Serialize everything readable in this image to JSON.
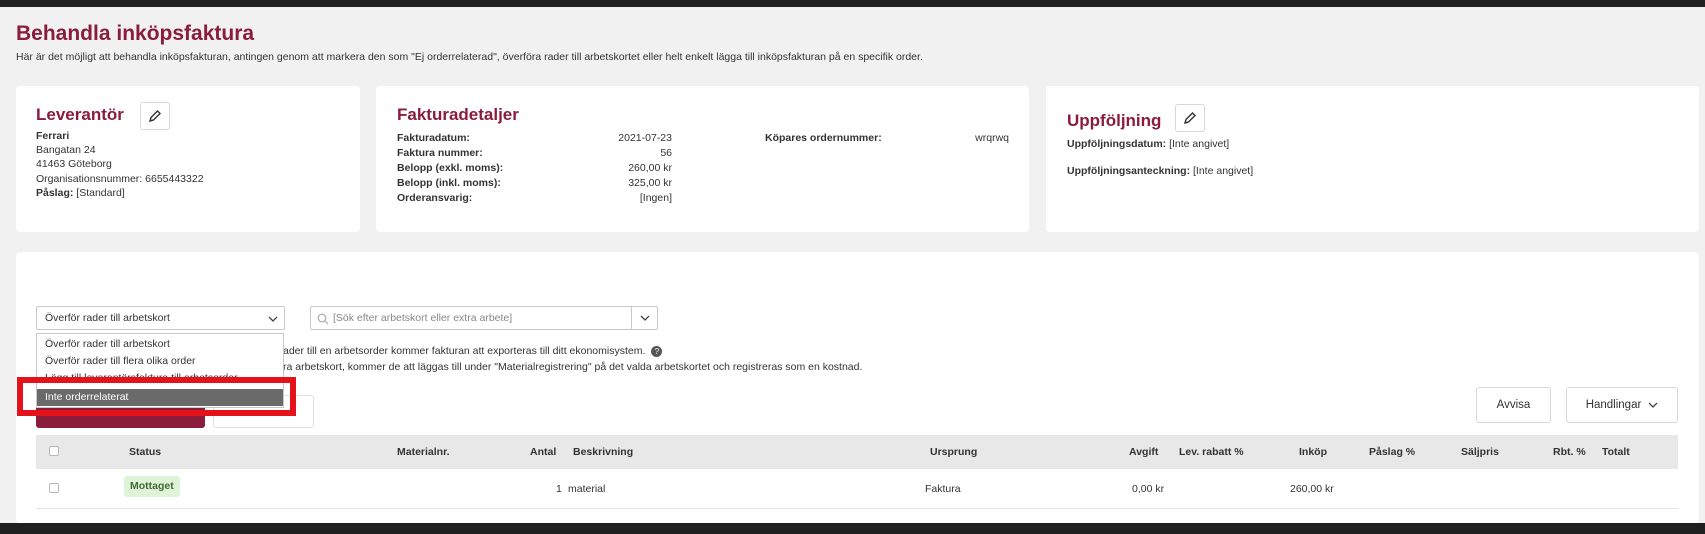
{
  "header": {
    "title": "Behandla inköpsfaktura",
    "subtitle": "Här är det möjligt att behandla inköpsfakturan, antingen genom att markera den som \"Ej orderrelaterad\", överföra rader till arbetskortet eller helt enkelt lägga till inköpsfakturan på en specifik order."
  },
  "supplier": {
    "title": "Leverantör",
    "name": "Ferrari",
    "street": "Bangatan 24",
    "city": "41463 Göteborg",
    "org_label": "Organisationsnummer:",
    "org_value": "6655443322",
    "markup_label": "Påslag:",
    "markup_value": "[Standard]"
  },
  "invoice": {
    "title": "Fakturadetaljer",
    "date_label": "Fakturadatum:",
    "date_value": "2021-07-23",
    "number_label": "Faktura nummer:",
    "number_value": "56",
    "excl_label": "Belopp (exkl. moms):",
    "excl_value": "260,00 kr",
    "incl_label": "Belopp (inkl. moms):",
    "incl_value": "325,00 kr",
    "resp_label": "Orderansvarig:",
    "resp_value": "[Ingen]",
    "buyer_label": "Köpares ordernummer:",
    "buyer_value": "wrqrwq"
  },
  "followup": {
    "title": "Uppföljning",
    "date_label": "Uppföljningsdatum:",
    "date_value": "[Inte angivet]",
    "note_label": "Uppföljningsanteckning:",
    "note_value": "[Inte angivet]"
  },
  "actions": {
    "mode_select_value": "Överför rader till arbetskort",
    "search_placeholder": "[Sök efter arbetskort eller extra arbete]",
    "info_line1": "ader till en arbetsorder kommer fakturan att exporteras till ditt ekonomisystem.",
    "info_line2": "ra arbetskort, kommer de att läggas till under \"Materialregistrering\" på det valda arbetskortet och registreras som en kostnad.",
    "dropdown_options": [
      "Överför rader till arbetskort",
      "Överför rader till flera olika order",
      "Lägg till leverantörsfaktura till arbetsorder",
      "Inte orderrelaterat"
    ],
    "reject_label": "Avvisa",
    "handlingar_label": "Handlingar"
  },
  "table": {
    "columns": [
      "Status",
      "Materialnr.",
      "Antal",
      "Beskrivning",
      "Ursprung",
      "Avgift",
      "Lev. rabatt %",
      "Inköp",
      "Påslag %",
      "Säljpris",
      "Rbt. %",
      "Totalt"
    ],
    "rows": [
      {
        "status": "Mottaget",
        "material_nr": "",
        "antal": "1",
        "beskrivning": "material",
        "ursprung": "Faktura",
        "avgift": "0,00 kr",
        "lev_rabatt": "",
        "inkop": "260,00 kr",
        "paslag": "",
        "saljpris": "",
        "rbt": "",
        "totalt": ""
      }
    ]
  },
  "colors": {
    "accent": "#8a1c3c",
    "highlight": "#e3121b",
    "status_bg": "#dff3d8"
  }
}
